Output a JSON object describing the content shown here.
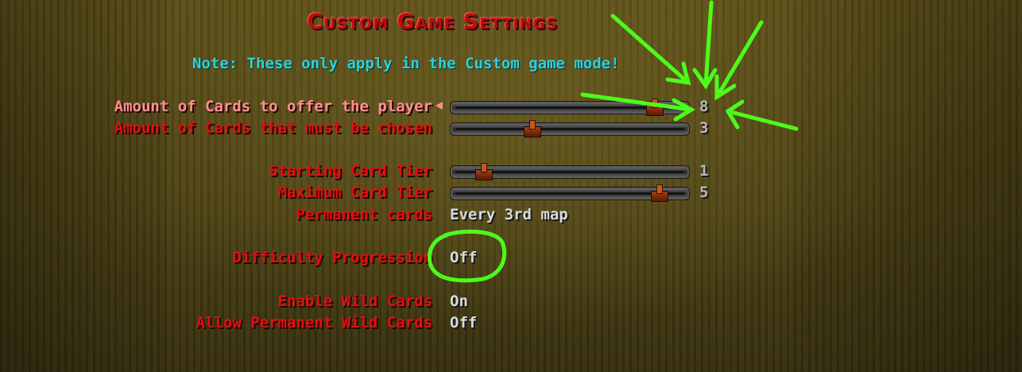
{
  "title": "Custom Game Settings",
  "note": "Note: These only apply in the Custom game mode!",
  "settings": {
    "cards_to_offer": {
      "label": "Amount of Cards to offer the player",
      "value": "8",
      "level": 0.9
    },
    "cards_chosen": {
      "label": "Amount of Cards that must be chosen",
      "value": "3",
      "level": 0.32
    },
    "starting_tier": {
      "label": "Starting Card Tier",
      "value": "1",
      "level": 0.09
    },
    "maximum_tier": {
      "label": "Maximum Card Tier",
      "value": "5",
      "level": 0.92
    },
    "permanent_cards": {
      "label": "Permanent cards",
      "value": "Every 3rd map"
    },
    "difficulty_progression": {
      "label": "Difficulty Progression",
      "value": "Off"
    },
    "enable_wild_cards": {
      "label": "Enable Wild Cards",
      "value": "On"
    },
    "allow_permanent_wild_cards": {
      "label": "Allow Permanent Wild Cards",
      "value": "Off"
    }
  },
  "colors": {
    "title": "#b80f0f",
    "note": "#2fd0d8",
    "label": "#e01010",
    "selected_label": "#ff9090",
    "value": "#d8d8d8",
    "annotation": "#4cff1a"
  },
  "icons": {
    "selection_cursor": "left-arrow-icon",
    "annotation_arrows": "arrow-icon",
    "annotation_circle": "circle-highlight-icon"
  }
}
